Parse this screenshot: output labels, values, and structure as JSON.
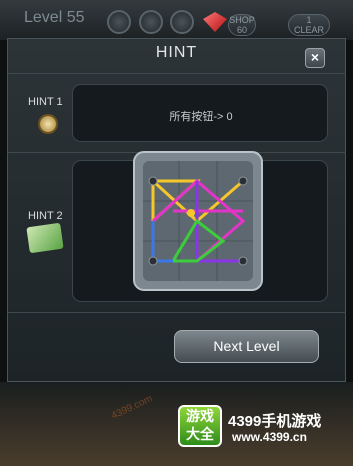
{
  "game_bar": {
    "level_label": "Level 55",
    "shop_label": "SHOP",
    "shop_count": "60",
    "clear_label": "CLEAR",
    "clear_count": "1"
  },
  "dialog": {
    "title": "HINT",
    "close_symbol": "×",
    "hints": [
      {
        "label": "HINT 1",
        "text": "所有按钮-> 0",
        "icon": "compass-icon"
      },
      {
        "label": "HINT 2",
        "icon": "map-icon"
      }
    ],
    "next_button": "Next Level"
  },
  "branding": {
    "badge": "游戏大全",
    "name": "4399手机游戏",
    "url": "www.4399.cn",
    "watermark": "4399.com"
  },
  "colors": {
    "line_yellow": "#f6c72a",
    "line_pink": "#e433c9",
    "line_purple": "#8b36e6",
    "line_green": "#3ccc3c",
    "line_blue": "#3a78e8"
  }
}
